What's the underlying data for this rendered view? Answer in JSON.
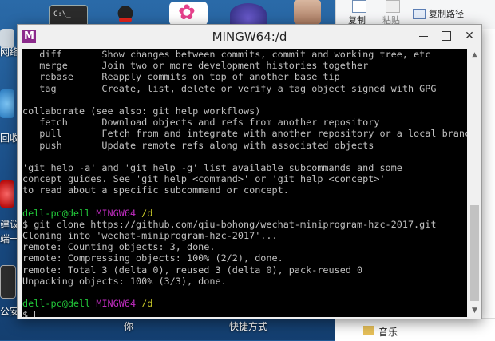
{
  "desktop": {
    "left_labels": [
      "网络",
      "回收",
      "建议",
      "端一",
      "公安"
    ],
    "bottom_labels": [
      "你",
      "快捷方式"
    ]
  },
  "explorer": {
    "ribbon": {
      "copy": "复制",
      "paste": "粘贴",
      "copy_path": "复制路径"
    },
    "file_name": "音乐"
  },
  "window": {
    "title": "MINGW64:/d",
    "app_icon": "M",
    "min": "minimize",
    "max": "maximize",
    "close": "✕"
  },
  "terminal": {
    "lines": [
      "   diff       Show changes between commits, commit and working tree, etc",
      "   merge      Join two or more development histories together",
      "   rebase     Reapply commits on top of another base tip",
      "   tag        Create, list, delete or verify a tag object signed with GPG",
      "",
      "collaborate (see also: git help workflows)",
      "   fetch      Download objects and refs from another repository",
      "   pull       Fetch from and integrate with another repository or a local branch",
      "   push       Update remote refs along with associated objects",
      "",
      "'git help -a' and 'git help -g' list available subcommands and some",
      "concept guides. See 'git help <command>' or 'git help <concept>'",
      "to read about a specific subcommand or concept.",
      ""
    ],
    "prompt1": {
      "user": "dell-pc@dell",
      "shell": "MINGW64",
      "path": "/d"
    },
    "command": "$ git clone https://github.com/qiu-bohong/wechat-miniprogram-hzc-2017.git",
    "output": [
      "Cloning into 'wechat-miniprogram-hzc-2017'...",
      "remote: Counting objects: 3, done.",
      "remote: Compressing objects: 100% (2/2), done.",
      "remote: Total 3 (delta 0), reused 3 (delta 0), pack-reused 0",
      "Unpacking objects: 100% (3/3), done.",
      ""
    ],
    "prompt2": {
      "user": "dell-pc@dell",
      "shell": "MINGW64",
      "path": "/d"
    },
    "input_prompt": "$ "
  },
  "colors": {
    "prompt_user": "#22c83a",
    "prompt_shell": "#c02cc0",
    "prompt_path": "#c8c828",
    "text": "#c0c0c0"
  }
}
